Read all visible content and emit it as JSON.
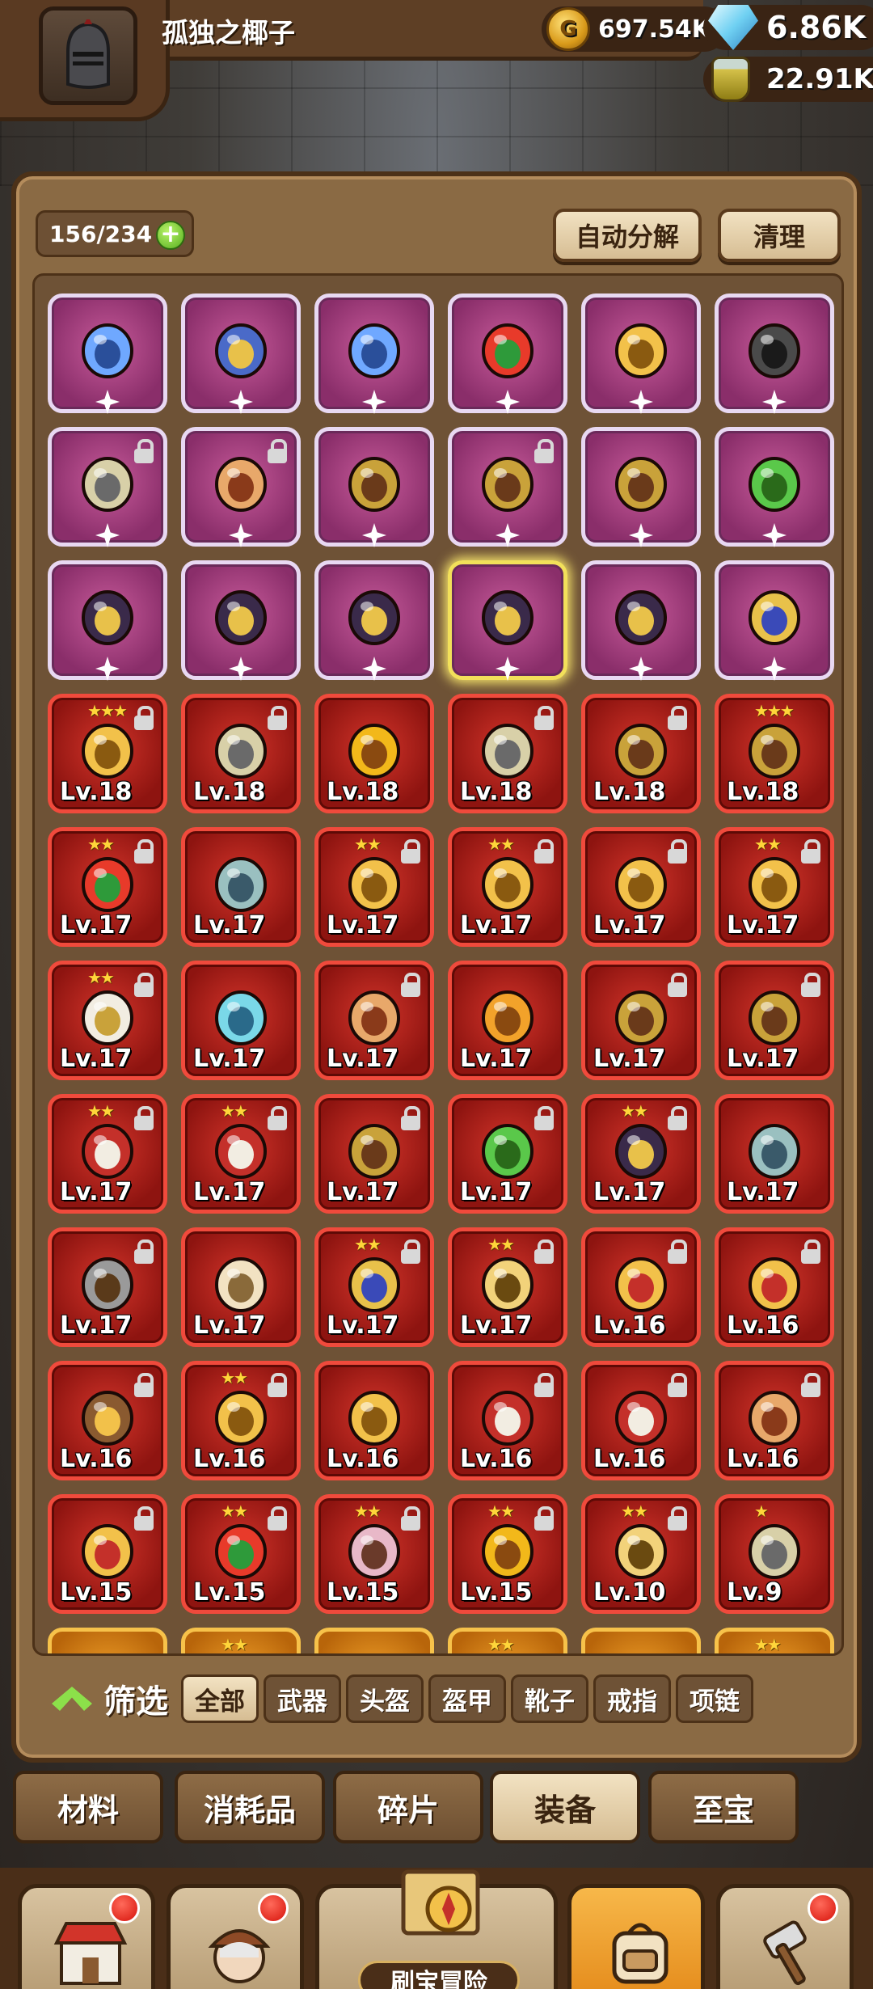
{
  "header": {
    "player_name": "孤独之椰子",
    "gold": "697.54K",
    "gems": "6.86K",
    "potions": "22.91K"
  },
  "inventory": {
    "capacity": "156/234",
    "auto_decompose_label": "自动分解",
    "clean_label": "清理"
  },
  "items": [
    {
      "icon": "sword-icon",
      "rarity": "purple",
      "level": "",
      "locked": false,
      "stars": ""
    },
    {
      "icon": "shield-icon",
      "rarity": "purple",
      "level": "",
      "locked": false,
      "stars": ""
    },
    {
      "icon": "sword-icon",
      "rarity": "purple",
      "level": "",
      "locked": false,
      "stars": ""
    },
    {
      "icon": "wand-icon",
      "rarity": "purple",
      "level": "",
      "locked": false,
      "stars": ""
    },
    {
      "icon": "staff-icon",
      "rarity": "purple",
      "level": "",
      "locked": false,
      "stars": ""
    },
    {
      "icon": "mask-icon",
      "rarity": "purple",
      "level": "",
      "locked": false,
      "stars": ""
    },
    {
      "icon": "helmet-icon",
      "rarity": "purple",
      "level": "",
      "locked": true,
      "stars": ""
    },
    {
      "icon": "ring-icon",
      "rarity": "purple",
      "level": "",
      "locked": true,
      "stars": ""
    },
    {
      "icon": "armor-icon",
      "rarity": "purple",
      "level": "",
      "locked": false,
      "stars": ""
    },
    {
      "icon": "armor-icon",
      "rarity": "purple",
      "level": "",
      "locked": true,
      "stars": ""
    },
    {
      "icon": "armor-icon",
      "rarity": "purple",
      "level": "",
      "locked": false,
      "stars": ""
    },
    {
      "icon": "cloak-icon",
      "rarity": "purple",
      "level": "",
      "locked": false,
      "stars": ""
    },
    {
      "icon": "boot-icon",
      "rarity": "purple",
      "level": "",
      "locked": false,
      "stars": ""
    },
    {
      "icon": "boot-icon",
      "rarity": "purple",
      "level": "",
      "locked": false,
      "stars": ""
    },
    {
      "icon": "boot-icon",
      "rarity": "purple",
      "level": "",
      "locked": false,
      "stars": ""
    },
    {
      "icon": "boot-icon",
      "rarity": "purple",
      "level": "",
      "locked": false,
      "stars": "",
      "selected": true
    },
    {
      "icon": "boot-icon",
      "rarity": "purple",
      "level": "",
      "locked": false,
      "stars": ""
    },
    {
      "icon": "necklace-icon",
      "rarity": "purple",
      "level": "",
      "locked": false,
      "stars": ""
    },
    {
      "icon": "staff-icon",
      "rarity": "red",
      "level": "Lv.18",
      "locked": true,
      "stars": "★★★"
    },
    {
      "icon": "helmet-icon",
      "rarity": "red",
      "level": "Lv.18",
      "locked": true,
      "stars": ""
    },
    {
      "icon": "sunflower-icon",
      "rarity": "red",
      "level": "Lv.18",
      "locked": false,
      "stars": ""
    },
    {
      "icon": "helmet-icon",
      "rarity": "red",
      "level": "Lv.18",
      "locked": true,
      "stars": ""
    },
    {
      "icon": "armor-icon",
      "rarity": "red",
      "level": "Lv.18",
      "locked": true,
      "stars": ""
    },
    {
      "icon": "armor-icon",
      "rarity": "red",
      "level": "Lv.18",
      "locked": false,
      "stars": "★★★"
    },
    {
      "icon": "wand-icon",
      "rarity": "red",
      "level": "Lv.17",
      "locked": true,
      "stars": "★★"
    },
    {
      "icon": "orb-icon",
      "rarity": "red",
      "level": "Lv.17",
      "locked": false,
      "stars": ""
    },
    {
      "icon": "staff-icon",
      "rarity": "red",
      "level": "Lv.17",
      "locked": true,
      "stars": "★★"
    },
    {
      "icon": "staff-icon",
      "rarity": "red",
      "level": "Lv.17",
      "locked": true,
      "stars": "★★"
    },
    {
      "icon": "staff-icon",
      "rarity": "red",
      "level": "Lv.17",
      "locked": true,
      "stars": ""
    },
    {
      "icon": "chalice-icon",
      "rarity": "red",
      "level": "Lv.17",
      "locked": true,
      "stars": "★★"
    },
    {
      "icon": "turban-icon",
      "rarity": "red",
      "level": "Lv.17",
      "locked": true,
      "stars": "★★"
    },
    {
      "icon": "tiara-icon",
      "rarity": "red",
      "level": "Lv.17",
      "locked": false,
      "stars": ""
    },
    {
      "icon": "ring-icon",
      "rarity": "red",
      "level": "Lv.17",
      "locked": true,
      "stars": ""
    },
    {
      "icon": "hat-icon",
      "rarity": "red",
      "level": "Lv.17",
      "locked": false,
      "stars": ""
    },
    {
      "icon": "armor-icon",
      "rarity": "red",
      "level": "Lv.17",
      "locked": true,
      "stars": ""
    },
    {
      "icon": "armor-icon",
      "rarity": "red",
      "level": "Lv.17",
      "locked": true,
      "stars": ""
    },
    {
      "icon": "robe-icon",
      "rarity": "red",
      "level": "Lv.17",
      "locked": true,
      "stars": "★★"
    },
    {
      "icon": "robe-icon",
      "rarity": "red",
      "level": "Lv.17",
      "locked": true,
      "stars": "★★"
    },
    {
      "icon": "armor-icon",
      "rarity": "red",
      "level": "Lv.17",
      "locked": true,
      "stars": ""
    },
    {
      "icon": "cloak-icon",
      "rarity": "red",
      "level": "Lv.17",
      "locked": true,
      "stars": ""
    },
    {
      "icon": "boot-icon",
      "rarity": "red",
      "level": "Lv.17",
      "locked": true,
      "stars": "★★"
    },
    {
      "icon": "orb-icon",
      "rarity": "red",
      "level": "Lv.17",
      "locked": false,
      "stars": ""
    },
    {
      "icon": "axe-icon",
      "rarity": "red",
      "level": "Lv.17",
      "locked": true,
      "stars": ""
    },
    {
      "icon": "bracelet-icon",
      "rarity": "red",
      "level": "Lv.17",
      "locked": false,
      "stars": ""
    },
    {
      "icon": "necklace-icon",
      "rarity": "red",
      "level": "Lv.17",
      "locked": true,
      "stars": "★★"
    },
    {
      "icon": "pocketwatch-icon",
      "rarity": "red",
      "level": "Lv.17",
      "locked": true,
      "stars": "★★"
    },
    {
      "icon": "bow-icon",
      "rarity": "red",
      "level": "Lv.16",
      "locked": true,
      "stars": ""
    },
    {
      "icon": "bow-icon",
      "rarity": "red",
      "level": "Lv.16",
      "locked": true,
      "stars": ""
    },
    {
      "icon": "crossbow-icon",
      "rarity": "red",
      "level": "Lv.16",
      "locked": true,
      "stars": ""
    },
    {
      "icon": "staff-icon",
      "rarity": "red",
      "level": "Lv.16",
      "locked": true,
      "stars": "★★"
    },
    {
      "icon": "chalice-icon",
      "rarity": "red",
      "level": "Lv.16",
      "locked": false,
      "stars": ""
    },
    {
      "icon": "robe-icon",
      "rarity": "red",
      "level": "Lv.16",
      "locked": true,
      "stars": ""
    },
    {
      "icon": "robe-icon",
      "rarity": "red",
      "level": "Lv.16",
      "locked": true,
      "stars": ""
    },
    {
      "icon": "ring-icon",
      "rarity": "red",
      "level": "Lv.16",
      "locked": true,
      "stars": ""
    },
    {
      "icon": "bow-icon",
      "rarity": "red",
      "level": "Lv.15",
      "locked": true,
      "stars": ""
    },
    {
      "icon": "wand-icon",
      "rarity": "red",
      "level": "Lv.15",
      "locked": true,
      "stars": "★★"
    },
    {
      "icon": "fan-icon",
      "rarity": "red",
      "level": "Lv.15",
      "locked": true,
      "stars": "★★"
    },
    {
      "icon": "sunflower-icon",
      "rarity": "red",
      "level": "Lv.15",
      "locked": true,
      "stars": "★★"
    },
    {
      "icon": "pocketwatch-icon",
      "rarity": "red",
      "level": "Lv.10",
      "locked": true,
      "stars": "★★"
    },
    {
      "icon": "helmet-icon",
      "rarity": "red",
      "level": "Lv.9",
      "locked": false,
      "stars": "★"
    },
    {
      "icon": "item-icon",
      "rarity": "orange",
      "level": "",
      "locked": false,
      "stars": ""
    },
    {
      "icon": "item-icon",
      "rarity": "orange",
      "level": "",
      "locked": false,
      "stars": "★★"
    },
    {
      "icon": "item-icon",
      "rarity": "orange",
      "level": "",
      "locked": false,
      "stars": ""
    },
    {
      "icon": "item-icon",
      "rarity": "orange",
      "level": "",
      "locked": false,
      "stars": "★★"
    },
    {
      "icon": "item-icon",
      "rarity": "orange",
      "level": "",
      "locked": false,
      "stars": ""
    },
    {
      "icon": "item-icon",
      "rarity": "orange",
      "level": "",
      "locked": false,
      "stars": "★★"
    }
  ],
  "filter": {
    "label": "筛选",
    "chips": [
      "全部",
      "武器",
      "头盔",
      "盔甲",
      "靴子",
      "戒指",
      "项链"
    ],
    "active_index": 0
  },
  "category_tabs": {
    "items": [
      "材料",
      "消耗品",
      "碎片",
      "装备",
      "至宝"
    ],
    "active_index": 3
  },
  "bottom_nav": {
    "center_label": "刷宝冒险",
    "items": [
      {
        "icon": "shop-icon",
        "badge": true
      },
      {
        "icon": "hero-icon",
        "badge": true
      },
      {
        "icon": "map-icon",
        "badge": false
      },
      {
        "icon": "backpack-icon",
        "badge": false,
        "active": true
      },
      {
        "icon": "forge-icon",
        "badge": true
      }
    ]
  },
  "colors": {
    "purple_rarity": "#8a2e6a",
    "red_rarity": "#8e1410",
    "orange_rarity": "#b8650a",
    "selected_glow": "#f5e26a",
    "panel": "#8a6a44"
  }
}
